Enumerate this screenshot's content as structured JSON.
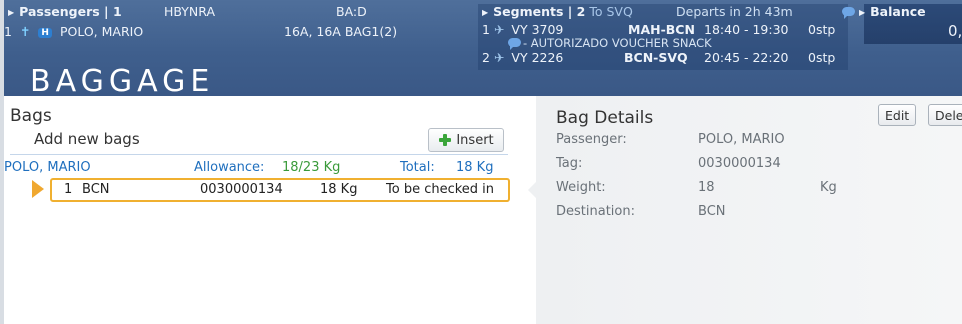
{
  "header": {
    "passengers_label": "Passengers | 1",
    "pnr": "HBYNRA",
    "ba": "BA:D",
    "passenger_index": "1",
    "passenger_badge": "H",
    "passenger_name": "POLO, MARIO",
    "seats_bags": "16A, 16A  BAG1(2)",
    "segments_label": "Segments | 2",
    "segments_dest": "To SVQ",
    "departs": "Departs in 2h 43m",
    "seg1_index": "1",
    "seg1_flight": "VY 3709",
    "seg1_route": "MAH-BCN",
    "seg1_time": "18:40 - 19:30",
    "seg1_stops": "0stp",
    "seg1_note": "- AUTORIZADO VOUCHER SNACK",
    "seg2_index": "2",
    "seg2_flight": "VY 2226",
    "seg2_route": "BCN-SVQ",
    "seg2_time": "20:45 - 22:20",
    "seg2_stops": "0stp",
    "balance_label": "Balance",
    "balance_value": "0,",
    "title": "BAGGAGE"
  },
  "bags": {
    "title": "Bags",
    "add_label": "Add new bags",
    "insert_label": "Insert",
    "passenger": "POLO, MARIO",
    "allowance_label": "Allowance:",
    "allowance_value": "18/23 Kg",
    "total_label": "Total:",
    "total_value": "18 Kg",
    "items": [
      {
        "index": "1",
        "dest": "BCN",
        "tag": "0030000134",
        "weight": "18 Kg",
        "status": "To be checked in"
      }
    ]
  },
  "details": {
    "title": "Bag Details",
    "edit_label": "Edit",
    "delete_label": "Dele",
    "passenger_label": "Passenger:",
    "passenger_value": "POLO, MARIO",
    "tag_label": "Tag:",
    "tag_value": "0030000134",
    "weight_label": "Weight:",
    "weight_value": "18",
    "weight_unit": "Kg",
    "destination_label": "Destination:",
    "destination_value": "BCN"
  },
  "colors": {
    "header_bg": "#3f5f8d",
    "highlight": "#f0b030",
    "link": "#1f6fbe",
    "green": "#3a9a3a"
  }
}
